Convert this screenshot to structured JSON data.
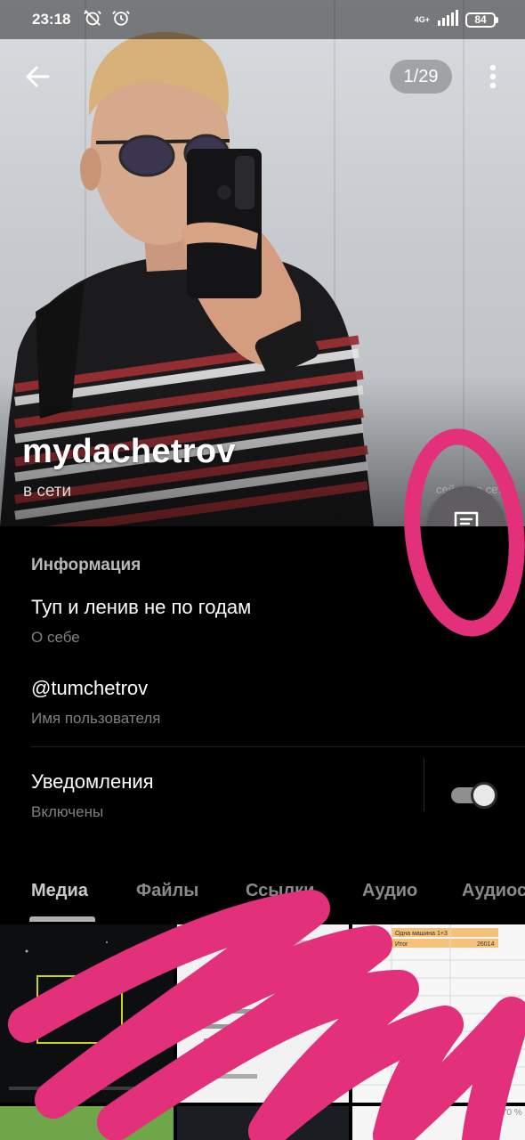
{
  "status_bar": {
    "time": "23:18",
    "network": "4G+",
    "battery": "84"
  },
  "header": {
    "photo_counter": "1/29"
  },
  "profile": {
    "name": "mydachetrov",
    "status": "в сети",
    "faded_caption": "сейчас в сети"
  },
  "info": {
    "section_title": "Информация",
    "bio": "Туп и ленив не по годам",
    "bio_label": "О себе",
    "username": "@tumchetrov",
    "username_label": "Имя пользователя",
    "notifications": "Уведомления",
    "notifications_state": "Включены",
    "notifications_enabled": true
  },
  "tabs": [
    "Медиа",
    "Файлы",
    "Ссылки",
    "Аудио",
    "Аудиос"
  ],
  "active_tab": "Медиа",
  "media": {
    "doc_lines": [
      "Одна машина 1+3",
      "Итог",
      "26014",
      "70 %"
    ]
  },
  "colors": {
    "accent_annotation": "#e3307a",
    "fab": "#5f5d5f",
    "background": "#000000"
  },
  "icons": [
    "back-arrow-icon",
    "more-vertical-icon",
    "chat-message-icon",
    "alarm-off-icon",
    "alarm-icon",
    "signal-icon",
    "battery-icon"
  ]
}
